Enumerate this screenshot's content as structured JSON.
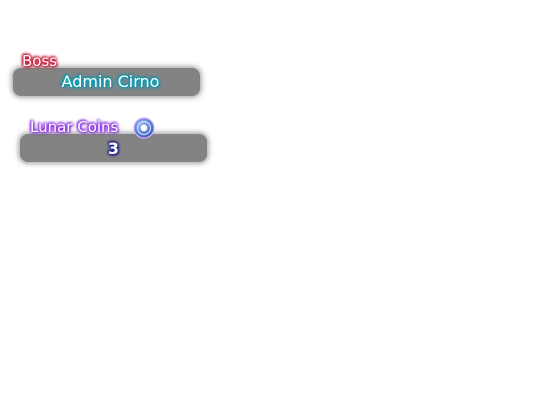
{
  "boss": {
    "label": "Boss",
    "name": "Admin Cirno"
  },
  "lunar_coins": {
    "label": "Lunar Coins",
    "value": "3",
    "icon": "lunar-coin-icon"
  },
  "colors": {
    "boss_label_glow": "#c8102e",
    "boss_name_glow": "#0b9fb8",
    "coins_label_glow": "#8a2be2",
    "coins_value_glow": "#1a1a8c",
    "panel_bg": "#838383",
    "coin_icon": "#5b7fd6"
  }
}
